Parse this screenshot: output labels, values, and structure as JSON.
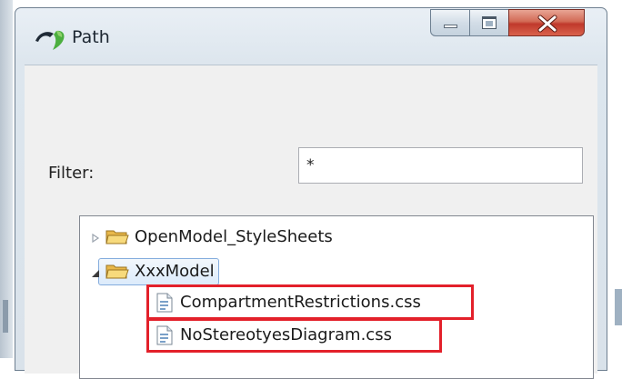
{
  "window": {
    "title": "Path",
    "app_icon": "eclipse-path-icon",
    "caption_buttons": [
      "minimize-icon",
      "maximize-icon",
      "close-icon"
    ]
  },
  "filter": {
    "label": "Filter:",
    "value": "*"
  },
  "tree": {
    "items": [
      {
        "label": "OpenModel_StyleSheets",
        "type": "folder",
        "expanded": false,
        "level": 0
      },
      {
        "label": "XxxModel",
        "type": "folder",
        "expanded": true,
        "selected": true,
        "level": 0
      },
      {
        "label": "CompartmentRestrictions.css",
        "type": "file",
        "level": 1,
        "highlighted": true
      },
      {
        "label": "NoStereotyesDiagram.css",
        "type": "file",
        "level": 1,
        "highlighted": true
      }
    ]
  },
  "colors": {
    "highlight": "#e3202a",
    "selection": "#dcebfb",
    "close_button": "#c0392b",
    "folder": "#f2c94c"
  }
}
